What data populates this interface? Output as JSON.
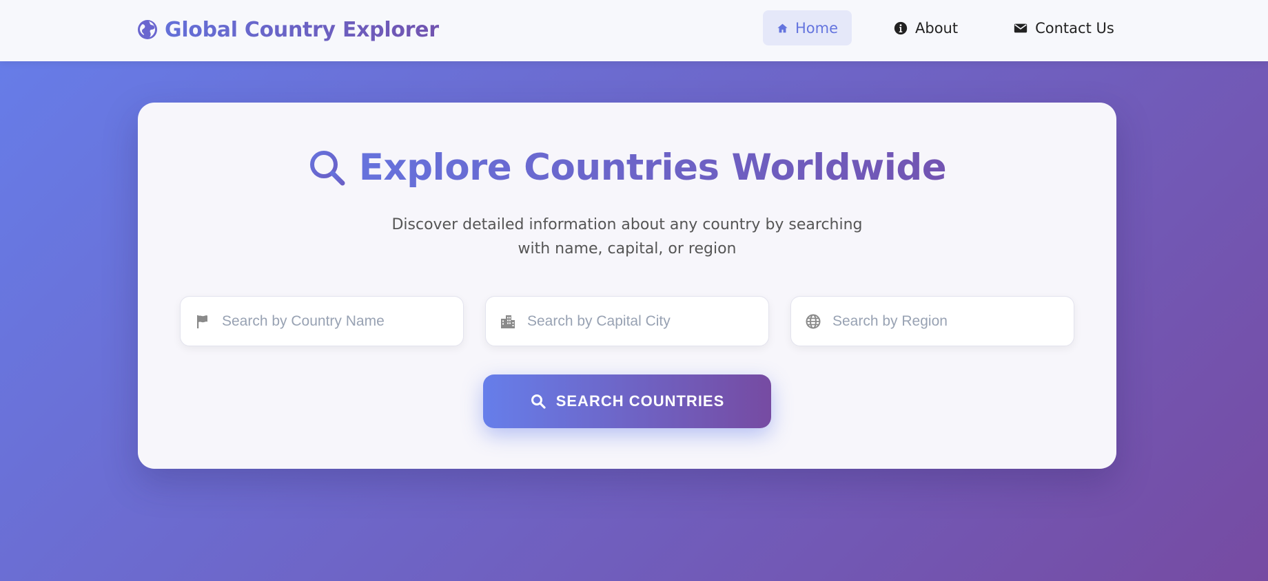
{
  "navbar": {
    "brand_icon": "globe-icon",
    "title": "Global Country Explorer",
    "links": [
      {
        "label": "Home",
        "icon": "home-icon",
        "active": true
      },
      {
        "label": "About",
        "icon": "info-icon",
        "active": false
      },
      {
        "label": "Contact Us",
        "icon": "envelope-icon",
        "active": false
      }
    ]
  },
  "hero": {
    "icon": "search-icon",
    "title": "Explore Countries Worldwide",
    "subtitle": "Discover detailed information about any country by searching with name, capital, or region"
  },
  "search": {
    "fields": [
      {
        "icon": "flag-icon",
        "value": "",
        "placeholder": "Search by Country Name"
      },
      {
        "icon": "city-icon",
        "value": "",
        "placeholder": "Search by Capital City"
      },
      {
        "icon": "globe-icon",
        "value": "",
        "placeholder": "Search by Region"
      }
    ],
    "button_label": "SEARCH COUNTRIES",
    "button_icon": "search-icon"
  },
  "colors": {
    "accent_start": "#667eea",
    "accent_end": "#764ba2",
    "nav_active_bg": "#e5e8f9",
    "placeholder": "#98a2b3"
  }
}
